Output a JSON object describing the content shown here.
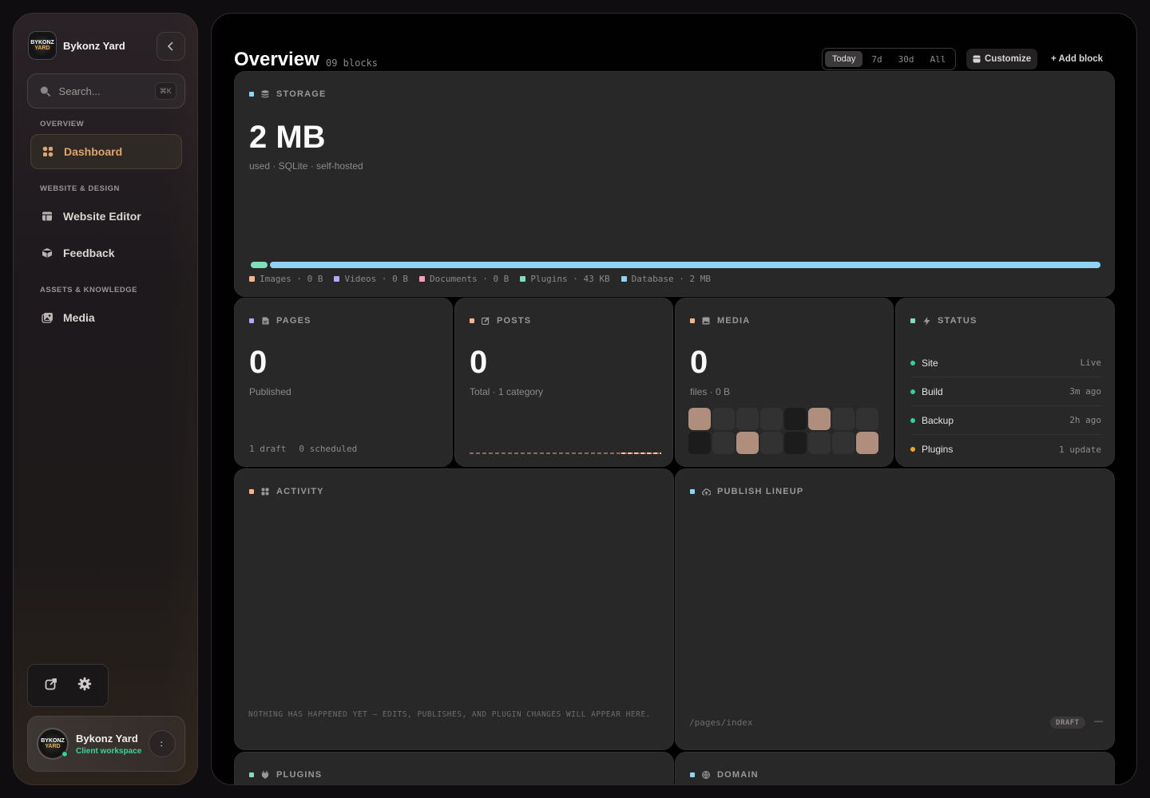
{
  "sidebar": {
    "brand": {
      "name": "Bykonz Yard",
      "logo_top": "BYKONZ",
      "logo_bottom": "YARD"
    },
    "search": {
      "placeholder": "Search...",
      "shortcut": "⌘K"
    },
    "sections": [
      {
        "label": "OVERVIEW",
        "items": [
          {
            "label": "Dashboard",
            "icon": "dashboard-icon",
            "active": true
          }
        ]
      },
      {
        "label": "WEBSITE & DESIGN",
        "items": [
          {
            "label": "Website Editor",
            "icon": "layout-icon"
          },
          {
            "label": "Feedback",
            "icon": "feedback-icon"
          }
        ]
      },
      {
        "label": "ASSETS & KNOWLEDGE",
        "items": [
          {
            "label": "Media",
            "icon": "media-icon"
          }
        ]
      }
    ],
    "user": {
      "name": "Bykonz Yard",
      "role": "Client workspace",
      "online_color": "#32d296"
    }
  },
  "main": {
    "title": "Overview",
    "block_count": "09 blocks",
    "ranges": [
      "Today",
      "7d",
      "30d",
      "All"
    ],
    "active_range": "Today",
    "customize_label": "Customize",
    "add_block_label": "+ Add block"
  },
  "storage": {
    "title": "STORAGE",
    "value": "2 MB",
    "subtitle": "used · SQLite · self-hosted",
    "usage_fraction": {
      "plugins": 0.02,
      "database": 0.98
    },
    "legend": [
      {
        "label": "Images · 0 B",
        "color": "#f6b48a"
      },
      {
        "label": "Videos · 0 B",
        "color": "#b9a4ff"
      },
      {
        "label": "Documents · 0 B",
        "color": "#f59ec0"
      },
      {
        "label": "Plugins · 43 KB",
        "color": "#7fe0b8"
      },
      {
        "label": "Database · 2 MB",
        "color": "#8fd3f5"
      }
    ]
  },
  "pages": {
    "title": "PAGES",
    "value": "0",
    "subtitle": "Published",
    "footer_draft": "1 draft",
    "footer_scheduled": "0 scheduled"
  },
  "posts": {
    "title": "POSTS",
    "value": "0",
    "subtitle": "Total · 1 category"
  },
  "media": {
    "title": "MEDIA",
    "value": "0",
    "subtitle": "files · 0 B"
  },
  "status": {
    "title": "STATUS",
    "rows": [
      {
        "label": "Site",
        "value": "Live",
        "color": "#32d296"
      },
      {
        "label": "Build",
        "value": "3m ago",
        "color": "#32d296"
      },
      {
        "label": "Backup",
        "value": "2h ago",
        "color": "#32d296"
      },
      {
        "label": "Plugins",
        "value": "1 update",
        "color": "#f5a623"
      }
    ]
  },
  "activity": {
    "title": "ACTIVITY",
    "empty": "NOTHING HAS HAPPENED YET — EDITS, PUBLISHES, AND PLUGIN CHANGES WILL APPEAR HERE."
  },
  "publish": {
    "title": "PUBLISH LINEUP",
    "path": "/pages/index",
    "badge": "DRAFT",
    "dash": "—"
  },
  "plugins": {
    "title": "PLUGINS"
  },
  "domain": {
    "title": "DOMAIN"
  }
}
